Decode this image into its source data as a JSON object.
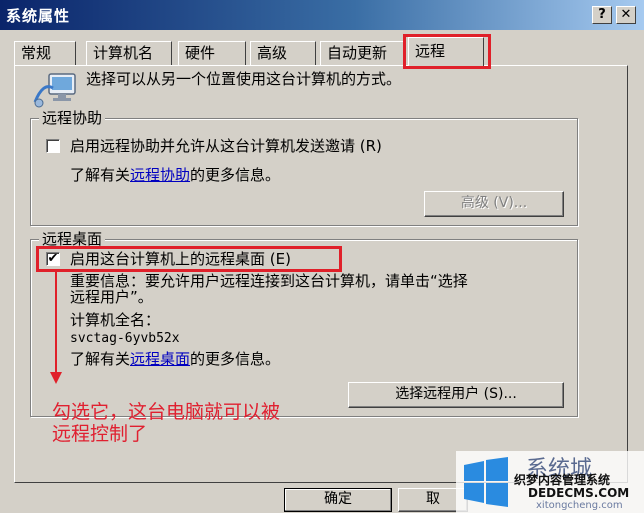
{
  "window": {
    "title": "系统属性",
    "help_btn": "?",
    "close_btn": "✕"
  },
  "tabs": [
    {
      "label": "常规"
    },
    {
      "label": "计算机名"
    },
    {
      "label": "硬件"
    },
    {
      "label": "高级"
    },
    {
      "label": "自动更新"
    },
    {
      "label": "远程",
      "active": true
    }
  ],
  "intro": "选择可以从另一个位置使用这台计算机的方式。",
  "remote_assistance": {
    "title": "远程协助",
    "checkbox_label": "启用远程协助并允许从这台计算机发送邀请 (R)",
    "checked": false,
    "learn_prefix": "了解有关",
    "learn_link": "远程协助",
    "learn_suffix": "的更多信息。",
    "advanced_button": "高级 (V)..."
  },
  "remote_desktop": {
    "title": "远程桌面",
    "checkbox_label": "启用这台计算机上的远程桌面 (E)",
    "checked": true,
    "notice_line1": "重要信息：要允许用户远程连接到这台计算机，请单击“选择",
    "notice_line2": "远程用户”。",
    "full_name_label": "计算机全名：",
    "full_name_value": "svctag-6yvb52x",
    "learn_prefix": "了解有关",
    "learn_link": "远程桌面",
    "learn_suffix": "的更多信息。",
    "select_users_button": "选择远程用户 (S)..."
  },
  "annotation": {
    "line1": "勾选它，这台电脑就可以被",
    "line2": "远程控制了"
  },
  "footer": {
    "ok_button": "确定",
    "cancel_button": "取"
  },
  "watermark": {
    "text1": "系统城",
    "text2": "织梦内容管理系统",
    "text3": "DEDECMS.COM",
    "text4": "xitongcheng.com"
  },
  "colors": {
    "accent_red": "#e0202a",
    "link_blue": "#0000c0",
    "dialog_face": "#d4d0c8"
  }
}
